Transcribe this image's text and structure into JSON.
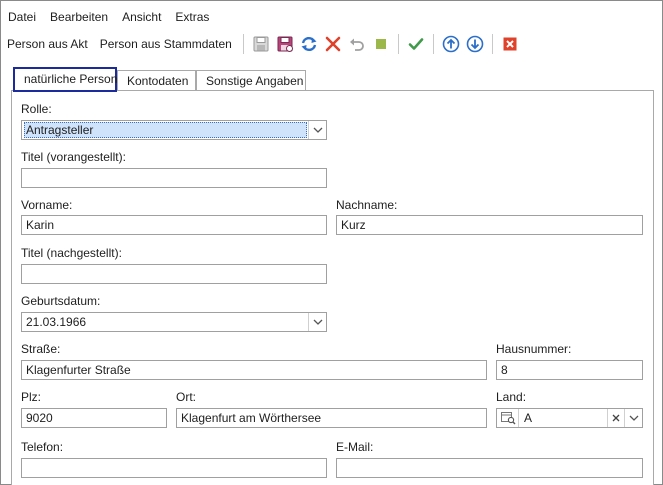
{
  "menu": [
    "Datei",
    "Bearbeiten",
    "Ansicht",
    "Extras"
  ],
  "toolbar": {
    "person_aus_akt": "Person aus Akt",
    "person_aus_stammdaten": "Person aus Stammdaten",
    "icons": [
      "save-icon",
      "save-as-icon",
      "refresh-icon",
      "delete-icon",
      "undo-icon",
      "stop-icon",
      "confirm-icon",
      "move-up-icon",
      "move-down-icon",
      "close-icon"
    ]
  },
  "tabs": [
    "natürliche Person",
    "Kontodaten",
    "Sonstige Angaben"
  ],
  "form": {
    "rolle": {
      "label": "Rolle:",
      "value": "Antragsteller"
    },
    "titel_vor": {
      "label": "Titel (vorangestellt):",
      "value": ""
    },
    "vorname": {
      "label": "Vorname:",
      "value": "Karin"
    },
    "nachname": {
      "label": "Nachname:",
      "value": "Kurz"
    },
    "titel_nach": {
      "label": "Titel (nachgestellt):",
      "value": ""
    },
    "geburtsdatum": {
      "label": "Geburtsdatum:",
      "value": "21.03.1966"
    },
    "strasse": {
      "label": "Straße:",
      "value": "Klagenfurter Straße"
    },
    "hausnummer": {
      "label": "Hausnummer:",
      "value": "8"
    },
    "plz": {
      "label": "Plz:",
      "value": "9020"
    },
    "ort": {
      "label": "Ort:",
      "value": "Klagenfurt am Wörthersee"
    },
    "land": {
      "label": "Land:",
      "value": "A"
    },
    "telefon": {
      "label": "Telefon:",
      "value": ""
    },
    "email": {
      "label": "E-Mail:",
      "value": ""
    }
  },
  "colors": {
    "tab_focus_border": "#1b2a9c",
    "selection_bg": "#cfe3fb",
    "delete_red": "#e0412b",
    "confirm_green": "#3f9a4a",
    "arrow_blue": "#2a6fc9"
  }
}
